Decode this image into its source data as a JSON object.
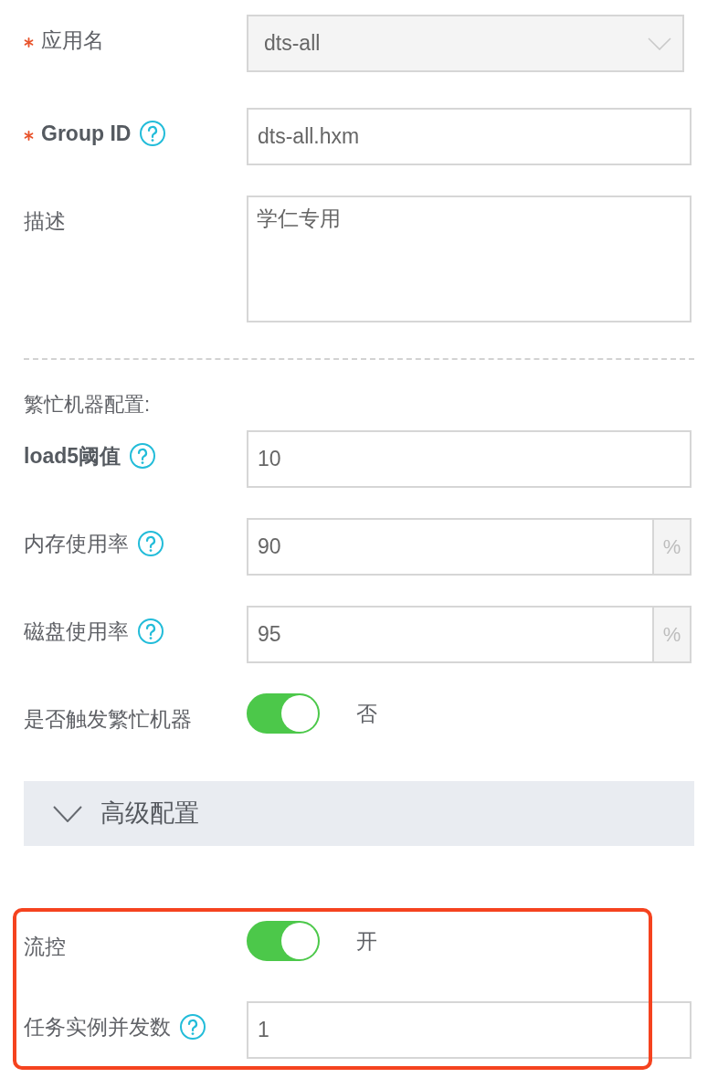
{
  "basic_fields": [
    {
      "kind": "select",
      "label": "应用名",
      "required": true,
      "help": false,
      "bold": false,
      "value": "dts-all"
    },
    {
      "kind": "text",
      "label": "Group ID",
      "required": true,
      "help": true,
      "bold": true,
      "value": "dts-all.hxm"
    },
    {
      "kind": "textarea",
      "label": "描述",
      "required": false,
      "help": false,
      "bold": false,
      "value": "学仁专用"
    }
  ],
  "busy_machine": {
    "heading": "繁忙机器配置:",
    "fields": [
      {
        "kind": "text",
        "label": "load5阈值",
        "required": false,
        "help": true,
        "bold": true,
        "value": "10"
      },
      {
        "kind": "text",
        "label": "内存使用率",
        "required": false,
        "help": true,
        "bold": false,
        "value": "90",
        "suffix": "%"
      },
      {
        "kind": "text",
        "label": "磁盘使用率",
        "required": false,
        "help": true,
        "bold": false,
        "value": "95",
        "suffix": "%"
      },
      {
        "kind": "toggle",
        "label": "是否触发繁忙机器",
        "required": false,
        "help": false,
        "bold": false,
        "on": true,
        "state_text": "否"
      }
    ]
  },
  "advanced": {
    "title": "高级配置",
    "expanded": true,
    "highlighted": true,
    "fields": [
      {
        "kind": "toggle",
        "label": "流控",
        "required": false,
        "help": false,
        "bold": false,
        "on": true,
        "state_text": "开"
      },
      {
        "kind": "text",
        "label": "任务实例并发数",
        "required": false,
        "help": true,
        "bold": false,
        "value": "1"
      }
    ]
  }
}
